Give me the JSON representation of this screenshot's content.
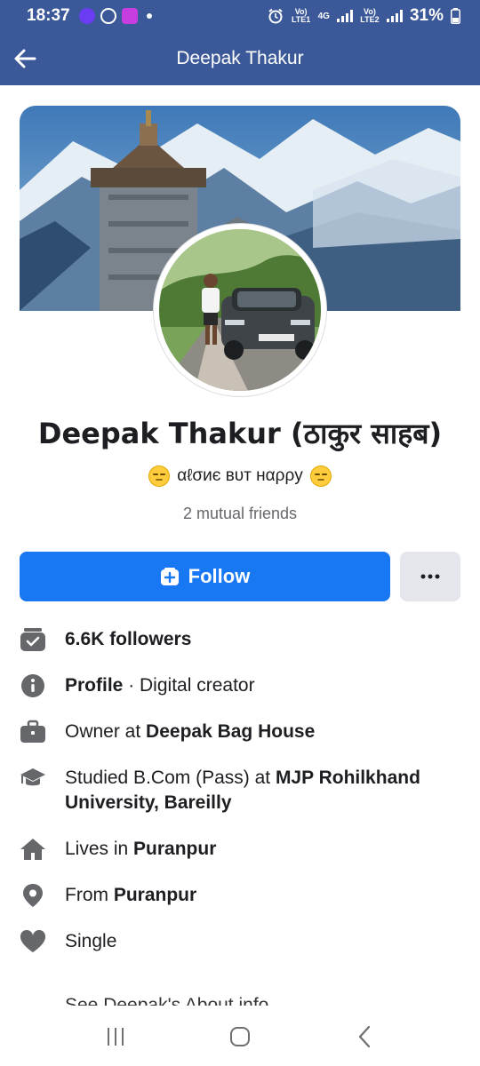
{
  "status_bar": {
    "time": "18:37",
    "network_1": "Vo) LTE1",
    "network_2": "4G",
    "network_3": "Vo) LTE2",
    "battery": "31%"
  },
  "header": {
    "title": "Deepak Thakur",
    "back_icon": "arrow-left-icon"
  },
  "profile": {
    "name": "Deepak Thakur (ठाकुर साहब)",
    "bio": "αℓσиє вυт нαρρу",
    "bio_emoji": "unamused-face-emoji",
    "mutual_friends": "2 mutual friends"
  },
  "actions": {
    "follow_label": "Follow",
    "more_label": "···"
  },
  "details": [
    {
      "icon": "followers-icon",
      "parts": [
        {
          "bold": true,
          "text": "6.6K followers"
        }
      ]
    },
    {
      "icon": "info-icon",
      "parts": [
        {
          "bold": true,
          "text": "Profile"
        },
        {
          "bold": false,
          "text": " · Digital creator"
        }
      ]
    },
    {
      "icon": "briefcase-icon",
      "parts": [
        {
          "bold": false,
          "text": "Owner at "
        },
        {
          "bold": true,
          "text": "Deepak Bag House"
        }
      ]
    },
    {
      "icon": "graduation-cap-icon",
      "parts": [
        {
          "bold": false,
          "text": "Studied B.Com (Pass) at "
        },
        {
          "bold": true,
          "text": "MJP Rohilkhand University, Bareilly"
        }
      ]
    },
    {
      "icon": "home-icon",
      "parts": [
        {
          "bold": false,
          "text": "Lives in "
        },
        {
          "bold": true,
          "text": "Puranpur"
        }
      ]
    },
    {
      "icon": "location-pin-icon",
      "parts": [
        {
          "bold": false,
          "text": "From "
        },
        {
          "bold": true,
          "text": "Puranpur"
        }
      ]
    },
    {
      "icon": "heart-icon",
      "parts": [
        {
          "bold": false,
          "text": "Single"
        }
      ]
    }
  ],
  "partial_text": "See Deepak's About info",
  "nav": {
    "recents_icon": "recent-apps-icon",
    "home_icon": "home-button-icon",
    "back_icon": "back-chevron-icon"
  },
  "colors": {
    "header_bg": "#3b5998",
    "follow_bg": "#1877f2",
    "more_bg": "#e4e6eb",
    "icon_gray": "#65676b"
  }
}
